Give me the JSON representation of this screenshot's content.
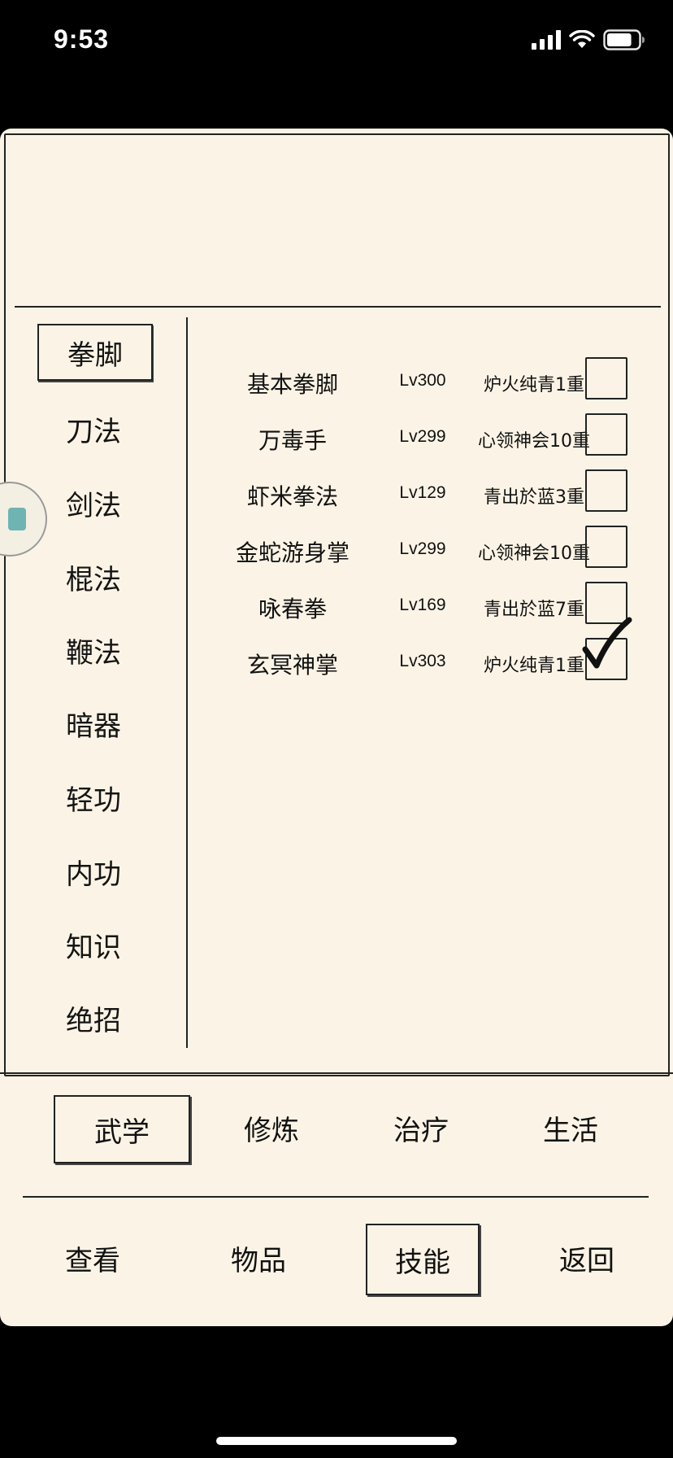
{
  "status_bar": {
    "time": "9:53",
    "battery_level": 0.8
  },
  "categories": [
    {
      "label": "拳脚",
      "active": true
    },
    {
      "label": "刀法",
      "active": false
    },
    {
      "label": "剑法",
      "active": false
    },
    {
      "label": "棍法",
      "active": false
    },
    {
      "label": "鞭法",
      "active": false
    },
    {
      "label": "暗器",
      "active": false
    },
    {
      "label": "轻功",
      "active": false
    },
    {
      "label": "内功",
      "active": false
    },
    {
      "label": "知识",
      "active": false
    },
    {
      "label": "绝招",
      "active": false
    }
  ],
  "skills": [
    {
      "name": "基本拳脚",
      "level": "Lv300",
      "stage": "炉火纯青1重",
      "checked": false
    },
    {
      "name": "万毒手",
      "level": "Lv299",
      "stage": "心领神会10重",
      "checked": false
    },
    {
      "name": "虾米拳法",
      "level": "Lv129",
      "stage": "青出於蓝3重",
      "checked": false
    },
    {
      "name": "金蛇游身掌",
      "level": "Lv299",
      "stage": "心领神会10重",
      "checked": false
    },
    {
      "name": "咏春拳",
      "level": "Lv169",
      "stage": "青出於蓝7重",
      "checked": false
    },
    {
      "name": "玄冥神掌",
      "level": "Lv303",
      "stage": "炉火纯青1重",
      "checked": true
    }
  ],
  "sub_tabs": [
    {
      "label": "武学",
      "active": true
    },
    {
      "label": "修炼",
      "active": false
    },
    {
      "label": "治疗",
      "active": false
    },
    {
      "label": "生活",
      "active": false
    }
  ],
  "bottom_nav": [
    {
      "label": "查看",
      "active": false
    },
    {
      "label": "物品",
      "active": false
    },
    {
      "label": "技能",
      "active": true
    },
    {
      "label": "返回",
      "active": false
    }
  ]
}
